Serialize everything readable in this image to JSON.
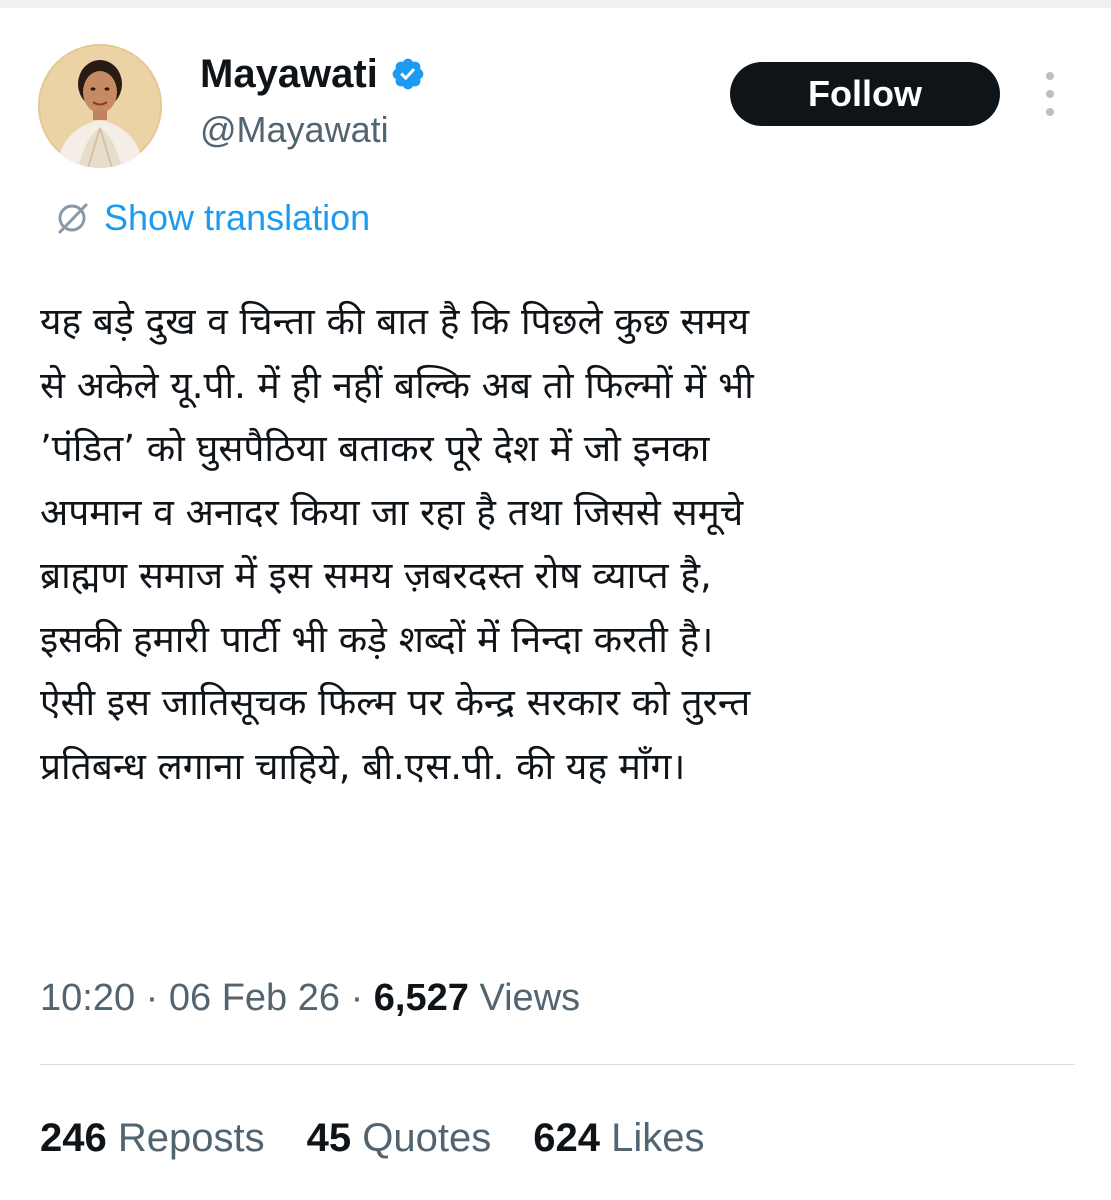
{
  "author": {
    "display_name": "Mayawati",
    "handle": "@Mayawati",
    "verified": true
  },
  "actions": {
    "follow_label": "Follow"
  },
  "translation": {
    "label": "Show translation"
  },
  "tweet": {
    "lines": [
      "यह बड़े दुख व चिन्ता की बात है कि पिछले कुछ समय",
      "से अकेले यू.पी. में ही नहीं बल्कि अब तो फिल्मों में भी",
      "’पंडित’ को घुसपैठिया बताकर पूरे देश में जो इनका",
      "अपमान व अनादर किया जा रहा है तथा जिससे समूचे",
      "ब्राह्मण समाज में इस समय ज़बरदस्त रोष व्याप्त है,",
      "इसकी हमारी पार्टी भी कड़े शब्दों में निन्दा करती है।",
      "ऐसी इस जातिसूचक फिल्म पर केन्द्र सरकार को तुरन्त",
      "प्रतिबन्ध लगाना चाहिये, बी.एस.पी. की यह माँग।"
    ]
  },
  "meta": {
    "time": "10:20",
    "separator": "·",
    "date": "06 Feb 26",
    "views_count": "6,527",
    "views_label": "Views"
  },
  "stats": {
    "reposts_count": "246",
    "reposts_label": "Reposts",
    "quotes_count": "45",
    "quotes_label": "Quotes",
    "likes_count": "624",
    "likes_label": "Likes"
  },
  "colors": {
    "text_primary": "#0f1419",
    "text_secondary": "#536471",
    "link_blue": "#1d9bf0",
    "verified_blue": "#1d9bf0",
    "follow_bg": "#0f1419",
    "follow_text": "#ffffff"
  },
  "icons": {
    "verified": "verified-badge-icon",
    "translate": "translate-icon",
    "more": "more-vertical-icon"
  }
}
